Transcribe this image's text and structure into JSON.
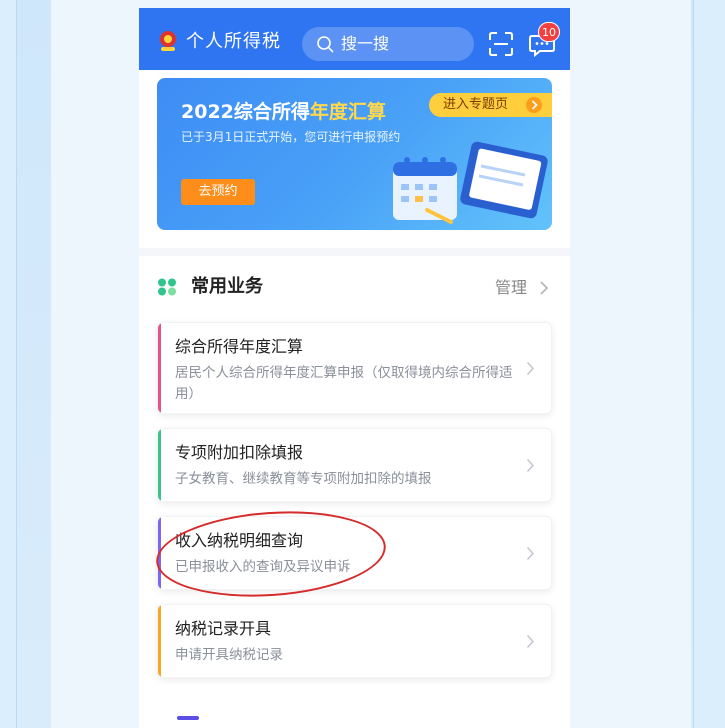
{
  "app": {
    "title": "个人所得税",
    "search_placeholder": "搜一搜",
    "message_badge": "10"
  },
  "banner": {
    "title_prefix": "2022综合所得",
    "title_highlight": "年度汇算",
    "description": "已于3月1日正式开始，您可进行申报预约",
    "reserve_button": "去预约",
    "topic_tag": "进入专题页"
  },
  "common_services": {
    "title": "常用业务",
    "manage_label": "管理",
    "items": [
      {
        "title": "综合所得年度汇算",
        "desc": "居民个人综合所得年度汇算申报（仅取得境内综合所得适用）",
        "accent": "#e8518a"
      },
      {
        "title": "专项附加扣除填报",
        "desc": "子女教育、继续教育等专项附加扣除的填报",
        "accent": "#3cc28a"
      },
      {
        "title": "收入纳税明细查询",
        "desc": "已申报收入的查询及异议申诉",
        "accent": "#7b68ee"
      },
      {
        "title": "纳税记录开具",
        "desc": "申请开具纳税记录",
        "accent": "#f5a623"
      }
    ]
  },
  "colors": {
    "header_blue": "#2f74f0",
    "annotation_red": "#d52b2b"
  }
}
